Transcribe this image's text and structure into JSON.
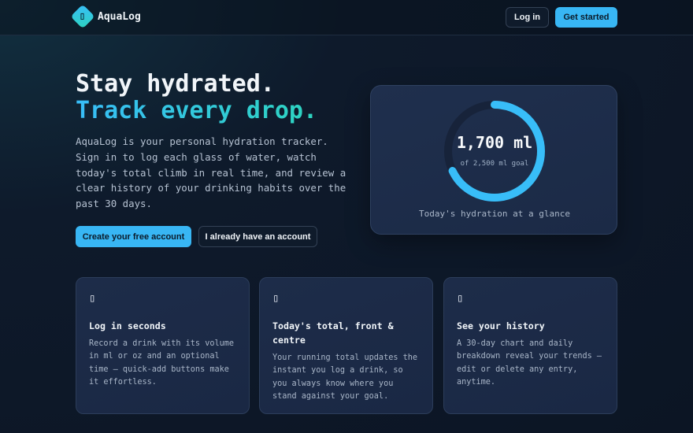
{
  "header": {
    "brand": "AquaLog",
    "login_label": "Log in",
    "get_started_label": "Get started"
  },
  "hero": {
    "title_line1": "Stay hydrated.",
    "title_line2": "Track every drop.",
    "description": "AquaLog is your personal hydration tracker. Sign in to log each glass of water, watch today's total climb in real time, and review a clear history of your drinking habits over the past 30 days.",
    "primary_cta": "Create your free account",
    "secondary_cta": "I already have an account"
  },
  "glance": {
    "total": "1,700 ml",
    "goal_text": "of 2,500 ml goal",
    "progress_fraction": 0.68,
    "caption": "Today's hydration at a glance",
    "accent_color": "#38bdf8"
  },
  "features": [
    {
      "icon": "lightning-icon",
      "title": "Log in seconds",
      "body": "Record a drink with its volume in ml or oz and an optional time — quick-add buttons make it effortless."
    },
    {
      "icon": "drop-icon",
      "title": "Today's total, front & centre",
      "body": "Your running total updates the instant you log a drink, so you always know where you stand against your goal."
    },
    {
      "icon": "chart-icon",
      "title": "See your history",
      "body": "A 30-day chart and daily breakdown reveal your trends — edit or delete any entry, anytime."
    }
  ]
}
